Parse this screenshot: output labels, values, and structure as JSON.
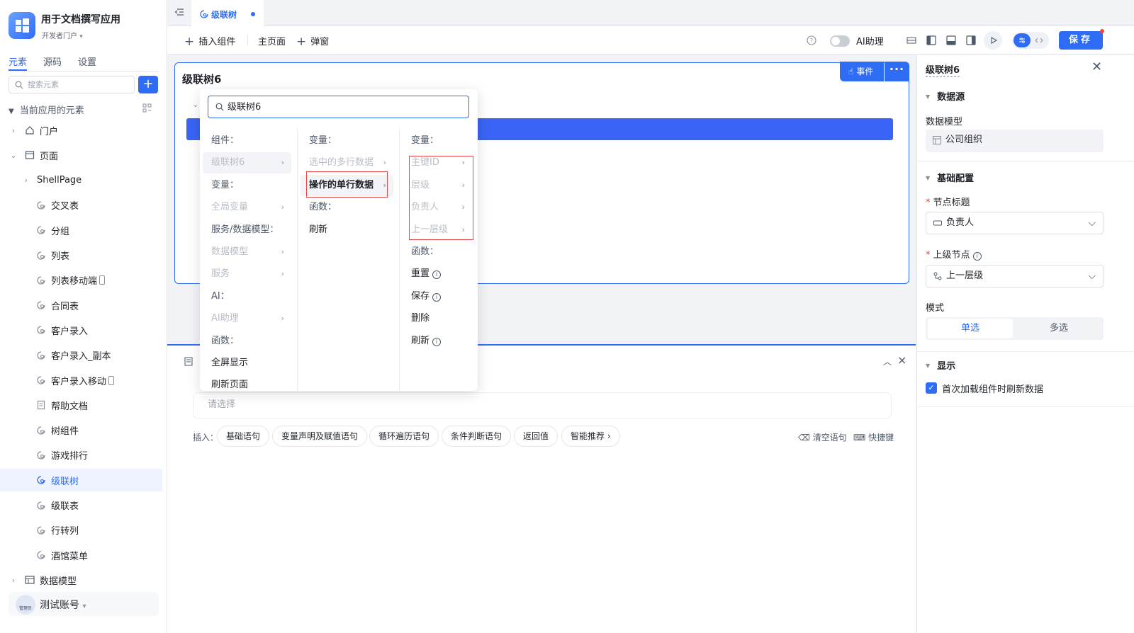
{
  "app": {
    "title": "用于文档撰写应用",
    "portal": "开发者门户"
  },
  "sidebar": {
    "tabs": [
      "元素",
      "源码",
      "设置"
    ],
    "search_placeholder": "搜索元素",
    "add_label": "+",
    "section_title": "当前应用的元素",
    "tree": [
      {
        "label": "门户",
        "level": 0,
        "expand": "collapsed",
        "icon": "home-icon"
      },
      {
        "label": "页面",
        "level": 0,
        "expand": "expanded",
        "icon": "page-icon"
      },
      {
        "label": "ShellPage",
        "level": 1,
        "expand": "collapsed",
        "icon": ""
      },
      {
        "label": "交叉表",
        "level": 2,
        "icon": "view-icon"
      },
      {
        "label": "分组",
        "level": 2,
        "icon": "view-icon"
      },
      {
        "label": "列表",
        "level": 2,
        "icon": "view-icon"
      },
      {
        "label": "列表移动端",
        "level": 2,
        "icon": "view-icon",
        "mobile": true
      },
      {
        "label": "合同表",
        "level": 2,
        "icon": "view-icon"
      },
      {
        "label": "客户录入",
        "level": 2,
        "icon": "view-icon"
      },
      {
        "label": "客户录入_副本",
        "level": 2,
        "icon": "view-icon"
      },
      {
        "label": "客户录入移动",
        "level": 2,
        "icon": "view-icon",
        "mobile": true
      },
      {
        "label": "帮助文档",
        "level": 2,
        "icon": "doc-icon"
      },
      {
        "label": "树组件",
        "level": 2,
        "icon": "view-icon"
      },
      {
        "label": "游戏排行",
        "level": 2,
        "icon": "view-icon"
      },
      {
        "label": "级联树",
        "level": 2,
        "icon": "view-icon",
        "active": true
      },
      {
        "label": "级联表",
        "level": 2,
        "icon": "view-icon"
      },
      {
        "label": "行转列",
        "level": 2,
        "icon": "view-icon"
      },
      {
        "label": "酒馆菜单",
        "level": 2,
        "icon": "view-icon"
      },
      {
        "label": "数据模型",
        "level": 0,
        "expand": "collapsed",
        "icon": "table-icon"
      }
    ],
    "account": {
      "name": "测试账号",
      "avatar_text": "管理员"
    }
  },
  "tabs": {
    "open": [
      {
        "label": "级联树",
        "unsaved": true
      }
    ]
  },
  "toolbar": {
    "insert_component": "插入组件",
    "main_page": "主页面",
    "popup": "弹窗",
    "ai_assistant": "AI助理",
    "save": "保存"
  },
  "canvas": {
    "component_title": "级联树6",
    "event_button": "事件",
    "more_button": "···"
  },
  "dropdown": {
    "search_value": "级联树6",
    "col1": [
      {
        "text": "组件：",
        "kind": "head"
      },
      {
        "text": "级联树6",
        "kind": "dis",
        "arrow": true,
        "selected": true
      },
      {
        "text": "变量：",
        "kind": "head"
      },
      {
        "text": "全局变量",
        "kind": "dis",
        "arrow": true
      },
      {
        "text": "服务/数据模型：",
        "kind": "head"
      },
      {
        "text": "数据模型",
        "kind": "dis",
        "arrow": true
      },
      {
        "text": "服务",
        "kind": "dis",
        "arrow": true
      },
      {
        "text": "AI：",
        "kind": "head"
      },
      {
        "text": "AI助理",
        "kind": "dis",
        "arrow": true
      },
      {
        "text": "函数：",
        "kind": "head"
      },
      {
        "text": "全屏显示",
        "kind": "act"
      },
      {
        "text": "刷新页面",
        "kind": "act"
      }
    ],
    "col2": [
      {
        "text": "变量：",
        "kind": "head"
      },
      {
        "text": "选中的多行数据",
        "kind": "dis",
        "arrow": true
      },
      {
        "text": "操作的单行数据",
        "kind": "bold",
        "arrow": true,
        "selected": true
      },
      {
        "text": "函数：",
        "kind": "head"
      },
      {
        "text": "刷新",
        "kind": "act"
      }
    ],
    "col3": [
      {
        "text": "变量：",
        "kind": "head"
      },
      {
        "text": "主键ID",
        "kind": "dis",
        "arrow": true
      },
      {
        "text": "层级",
        "kind": "dis",
        "arrow": true
      },
      {
        "text": "负责人",
        "kind": "dis",
        "arrow": true
      },
      {
        "text": "上一层级",
        "kind": "dis",
        "arrow": true
      },
      {
        "text": "函数：",
        "kind": "head"
      },
      {
        "text": "重置",
        "kind": "act",
        "info": true
      },
      {
        "text": "保存",
        "kind": "act",
        "info": true
      },
      {
        "text": "删除",
        "kind": "act"
      },
      {
        "text": "刷新",
        "kind": "act",
        "info": true
      }
    ]
  },
  "logic_panel": {
    "input_placeholder": "请选择",
    "insert_label": "插入：",
    "chips": [
      "基础语句",
      "变量声明及赋值语句",
      "循环遍历语句",
      "条件判断语句",
      "返回值",
      "智能推荐 ›"
    ],
    "clear": "清空语句",
    "shortcuts": "快捷键"
  },
  "right_panel": {
    "title": "级联树6",
    "sections": {
      "datasource": "数据源",
      "basic": "基础配置",
      "display": "显示"
    },
    "data_model_label": "数据模型",
    "data_model_value": "公司组织",
    "node_title_label": "节点标题",
    "node_title_value": "负责人",
    "parent_node_label": "上级节点",
    "parent_node_value": "上一层级",
    "mode_label": "模式",
    "mode_options": [
      "单选",
      "多选"
    ],
    "mode_selected": "单选",
    "refresh_on_load_label": "首次加载组件时刷新数据",
    "refresh_on_load": true
  },
  "colors": {
    "accent": "#2f6cf6",
    "highlight": "#e64545",
    "tree_bar": "#3964f5"
  }
}
